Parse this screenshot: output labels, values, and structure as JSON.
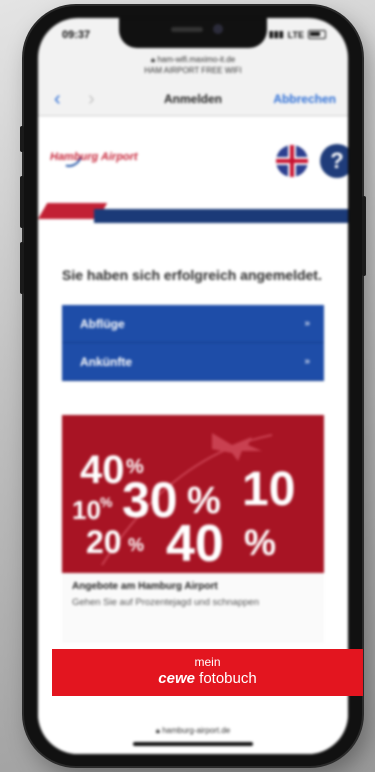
{
  "status": {
    "time": "09:37",
    "network": "LTE"
  },
  "browser": {
    "url": "ham-wifi.maximo-it.de",
    "site_name": "HAM AIRPORT FREE WIFI",
    "page_title": "Anmelden",
    "cancel_label": "Abbrechen",
    "footer_url": "hamburg-airport.de"
  },
  "header": {
    "logo_text": "Hamburg Airport",
    "help_symbol": "?"
  },
  "main": {
    "success_message": "Sie haben sich erfolgreich angemeldet.",
    "links": [
      {
        "label": "Abflüge",
        "arrow": "»"
      },
      {
        "label": "Ankünfte",
        "arrow": "»"
      }
    ],
    "promo": {
      "image_text": [
        "40",
        "%",
        "30",
        "%",
        "10",
        "10",
        "%",
        "20",
        "%",
        "40",
        "%"
      ],
      "title": "Angebote am Hamburg Airport",
      "body": "Gehen Sie auf Prozentejagd und schnappen"
    }
  },
  "ad": {
    "line1": "mein",
    "brand": "cewe",
    "product": "fotobuch"
  },
  "colors": {
    "link_blue": "#2e6fd6",
    "button_blue": "#1e4da8",
    "brand_red": "#c22034",
    "promo_red": "#a81424",
    "ad_red": "#e3151f"
  }
}
